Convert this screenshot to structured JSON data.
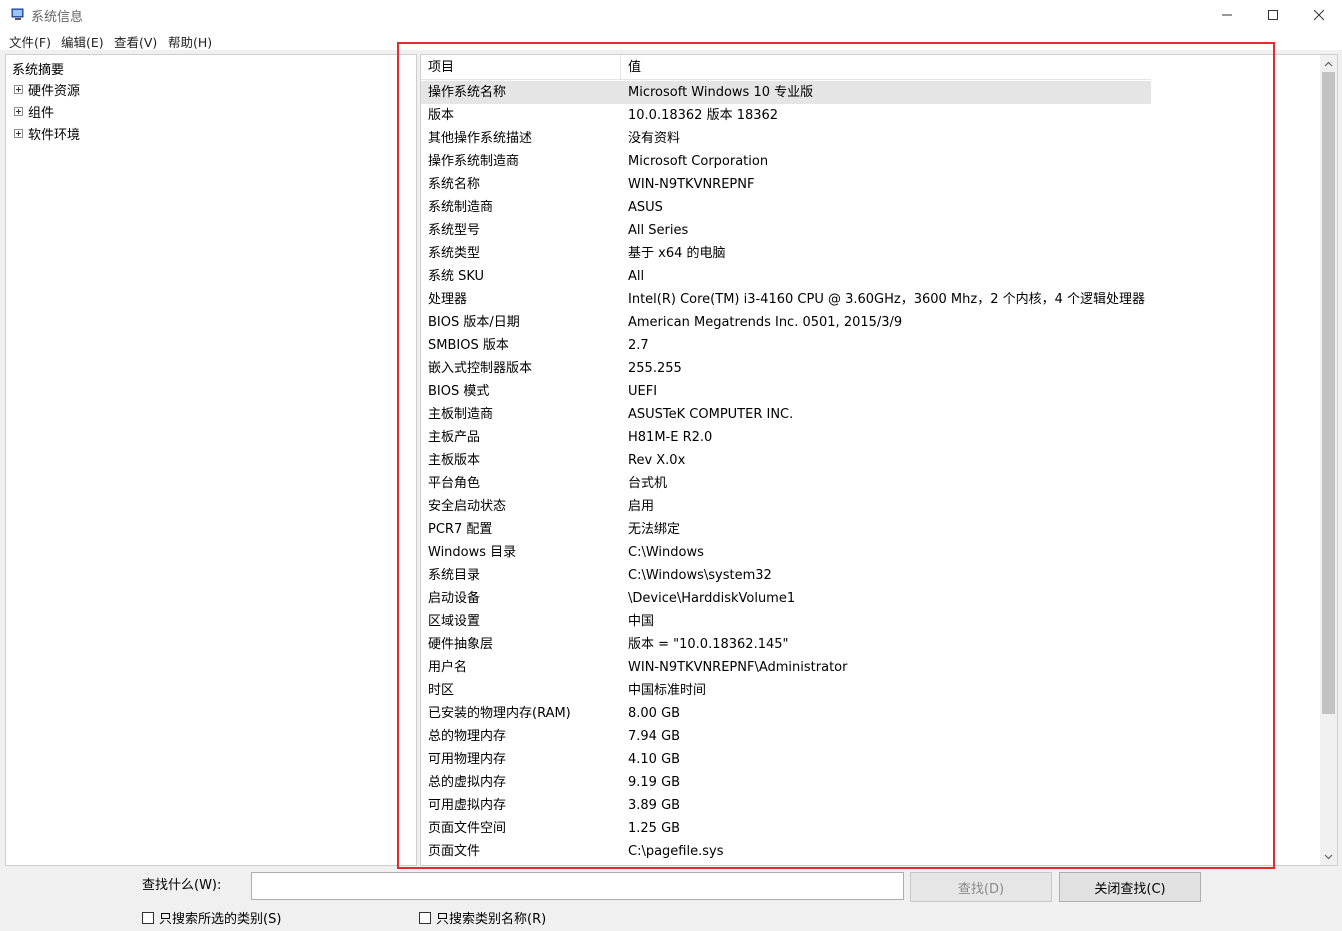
{
  "window": {
    "title": "系统信息",
    "icon": "system-info-icon"
  },
  "menu": [
    "文件(F)",
    "编辑(E)",
    "查看(V)",
    "帮助(H)"
  ],
  "tree": {
    "root": "系统摘要",
    "children": [
      "硬件资源",
      "组件",
      "软件环境"
    ]
  },
  "list": {
    "headers": [
      "项目",
      "值"
    ],
    "selected_row": 0,
    "rows": [
      [
        "操作系统名称",
        "Microsoft Windows 10 专业版"
      ],
      [
        "版本",
        "10.0.18362 版本 18362"
      ],
      [
        "其他操作系统描述",
        "没有资料"
      ],
      [
        "操作系统制造商",
        "Microsoft Corporation"
      ],
      [
        "系统名称",
        "WIN-N9TKVNREPNF"
      ],
      [
        "系统制造商",
        "ASUS"
      ],
      [
        "系统型号",
        "All Series"
      ],
      [
        "系统类型",
        "基于 x64 的电脑"
      ],
      [
        "系统 SKU",
        "All"
      ],
      [
        "处理器",
        "Intel(R) Core(TM) i3-4160 CPU @ 3.60GHz，3600 Mhz，2 个内核，4 个逻辑处理器"
      ],
      [
        "BIOS 版本/日期",
        "American Megatrends Inc. 0501, 2015/3/9"
      ],
      [
        "SMBIOS 版本",
        "2.7"
      ],
      [
        "嵌入式控制器版本",
        "255.255"
      ],
      [
        "BIOS 模式",
        "UEFI"
      ],
      [
        "主板制造商",
        "ASUSTeK COMPUTER INC."
      ],
      [
        "主板产品",
        "H81M-E R2.0"
      ],
      [
        "主板版本",
        "Rev X.0x"
      ],
      [
        "平台角色",
        "台式机"
      ],
      [
        "安全启动状态",
        "启用"
      ],
      [
        "PCR7 配置",
        "无法绑定"
      ],
      [
        "Windows 目录",
        "C:\\Windows"
      ],
      [
        "系统目录",
        "C:\\Windows\\system32"
      ],
      [
        "启动设备",
        "\\Device\\HarddiskVolume1"
      ],
      [
        "区域设置",
        "中国"
      ],
      [
        "硬件抽象层",
        "版本 = \"10.0.18362.145\""
      ],
      [
        "用户名",
        "WIN-N9TKVNREPNF\\Administrator"
      ],
      [
        "时区",
        "中国标准时间"
      ],
      [
        "已安装的物理内存(RAM)",
        "8.00 GB"
      ],
      [
        "总的物理内存",
        "7.94 GB"
      ],
      [
        "可用物理内存",
        "4.10 GB"
      ],
      [
        "总的虚拟内存",
        "9.19 GB"
      ],
      [
        "可用虚拟内存",
        "3.89 GB"
      ],
      [
        "页面文件空间",
        "1.25 GB"
      ],
      [
        "页面文件",
        "C:\\pagefile.sys"
      ]
    ]
  },
  "find": {
    "label": "查找什么(W):",
    "input_value": "",
    "find_button": "查找(D)",
    "close_button": "关闭查找(C)",
    "check_selected_category": "只搜索所选的类别(S)",
    "check_category_names": "只搜索类别名称(R)"
  },
  "colors": {
    "highlight_border": "#e52b2b",
    "selected_row_bg": "#e5e5e5"
  }
}
